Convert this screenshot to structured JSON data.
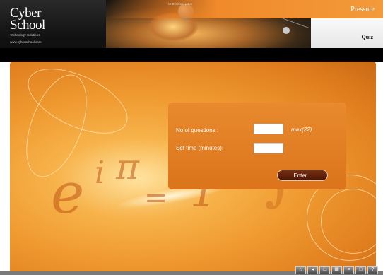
{
  "brand": {
    "logo_line1": "Cyber",
    "logo_line2": "School",
    "tagline": "Technology Solutions",
    "url": "www.cyberschool.com"
  },
  "header": {
    "breadcrumb": "M-OC Dom L 5.6",
    "title": "Pressure",
    "nav_quiz": "Quiz"
  },
  "form": {
    "questions_label": "No of questions :",
    "questions_value": "",
    "max_text": "max(22)",
    "time_label": "Set time (minutes):",
    "time_value": "",
    "enter_label": "Enter..."
  },
  "background_glyphs": {
    "e": "e",
    "i": "i",
    "pi": "π",
    "eq": "=",
    "one": "1",
    "integral": "∫"
  },
  "footer_icons": [
    "home-icon",
    "back-icon",
    "print-icon",
    "grid-icon",
    "list-icon",
    "window-icon",
    "help-icon"
  ],
  "colors": {
    "accent_orange": "#f08a2a",
    "panel": "#e07e22",
    "button": "#5a1f0a"
  }
}
